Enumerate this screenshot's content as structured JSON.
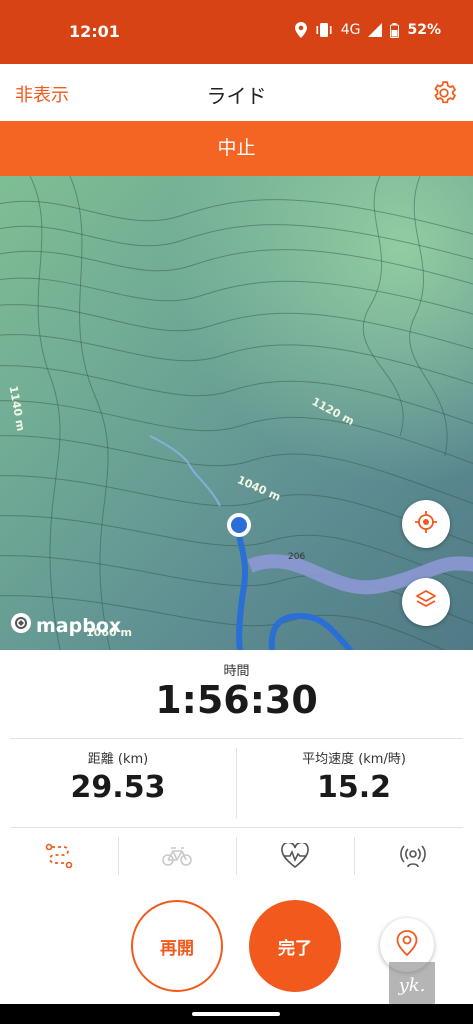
{
  "status_bar": {
    "time": "12:01",
    "network": "4G",
    "battery": "52%",
    "icons": [
      "location-icon",
      "vibrate-icon",
      "signal-icon",
      "battery-icon"
    ]
  },
  "header": {
    "hide_label": "非表示",
    "title": "ライド",
    "settings_icon": "gear-icon"
  },
  "banner": {
    "text": "中止"
  },
  "map": {
    "contour_labels": [
      "1120 m",
      "1040 m",
      "1140 m",
      "1060 m"
    ],
    "road_label": "206",
    "attribution": "mapbox",
    "buttons": [
      "recenter-icon",
      "layers-icon"
    ]
  },
  "stats": {
    "time_label": "時間",
    "time_value": "1:56:30",
    "distance_label": "距離 (km)",
    "distance_value": "29.53",
    "avg_speed_label": "平均速度 (km/時)",
    "avg_speed_value": "15.2"
  },
  "tabs": [
    {
      "icon": "route-icon",
      "active": true
    },
    {
      "icon": "bike-icon",
      "active": false
    },
    {
      "icon": "heart-rate-icon",
      "active": false
    },
    {
      "icon": "beacon-signal-icon",
      "active": false
    }
  ],
  "actions": {
    "resume_label": "再開",
    "finish_label": "完了"
  },
  "watermark": "yk.",
  "colors": {
    "brand": "#f25a1d",
    "status_bar": "#d84315",
    "route": "#2a6fd6"
  }
}
